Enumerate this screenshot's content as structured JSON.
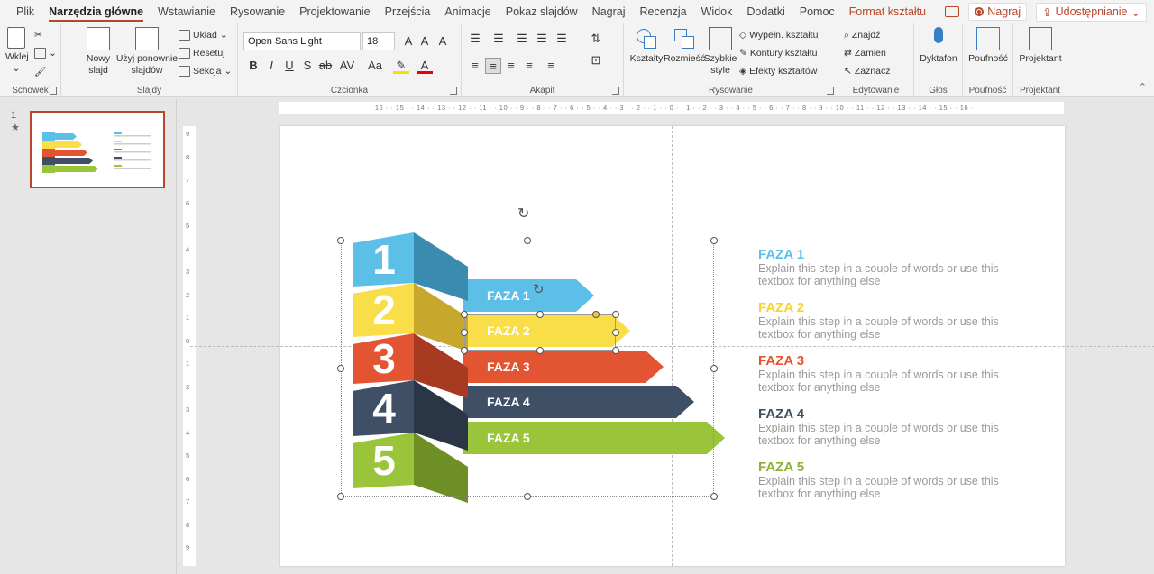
{
  "menu": {
    "tabs": [
      "Plik",
      "Narzędzia główne",
      "Wstawianie",
      "Rysowanie",
      "Projektowanie",
      "Przejścia",
      "Animacje",
      "Pokaz slajdów",
      "Nagraj",
      "Recenzja",
      "Widok",
      "Dodatki",
      "Pomoc",
      "Format kształtu"
    ],
    "record": "Nagraj",
    "share": "Udostępnianie"
  },
  "ribbon": {
    "clipboard": {
      "paste": "Wklej",
      "label": "Schowek"
    },
    "slides": {
      "new_slide": "Nowy slajd",
      "reuse": "Użyj ponownie slajdów",
      "layout": "Układ",
      "reset": "Resetuj",
      "section": "Sekcja",
      "label": "Slajdy"
    },
    "font": {
      "name": "Open Sans Light",
      "size": "18",
      "label": "Czcionka"
    },
    "paragraph": {
      "label": "Akapit"
    },
    "drawing": {
      "shapes": "Kształty",
      "arrange": "Rozmieść",
      "quick_styles": "Szybkie style",
      "fill": "Wypełn. kształtu",
      "outline": "Kontury kształtu",
      "effects": "Efekty kształtów",
      "label": "Rysowanie"
    },
    "editing": {
      "find": "Znajdź",
      "replace": "Zamień",
      "select": "Zaznacz",
      "label": "Edytowanie"
    },
    "voice": {
      "dictate": "Dyktafon",
      "label": "Głos"
    },
    "sensitivity": {
      "btn": "Poufność",
      "label": "Poufność"
    },
    "designer": {
      "btn": "Projektant",
      "label": "Projektant"
    }
  },
  "ruler": {
    "h": "· 16 · · 15 · · 14 · · 13 · · 12 · · 11 · · 10 · · 9 · · 8 · · 7 · · 6 · · 5 · · 4 · · 3 · · 2 · · 1 · · 0 · · 1 · · 2 · · 3 · · 4 · · 5 · · 6 · · 7 · · 8 · · 9 · · 10 · · 11 · · 12 · · 13 · · 14 · · 15 · · 16 ·",
    "v": [
      "9",
      "8",
      "7",
      "6",
      "5",
      "4",
      "3",
      "2",
      "1",
      "0",
      "1",
      "2",
      "3",
      "4",
      "5",
      "6",
      "7",
      "8",
      "9"
    ]
  },
  "thumbs": {
    "num": "1",
    "star": "★"
  },
  "slide": {
    "steps": [
      {
        "num": "1",
        "label": "FAZA 1",
        "color": "#5bbfe8",
        "side": "#3a8bb0"
      },
      {
        "num": "2",
        "label": "FAZA 2",
        "color": "#f9de4a",
        "side": "#c8a82c"
      },
      {
        "num": "3",
        "label": "FAZA 3",
        "color": "#e35532",
        "side": "#a93a22"
      },
      {
        "num": "4",
        "label": "FAZA 4",
        "color": "#3f4f66",
        "side": "#2a3546"
      },
      {
        "num": "5",
        "label": "FAZA 5",
        "color": "#9ac43a",
        "side": "#6d8f25"
      }
    ],
    "texts": [
      {
        "title": "FAZA 1",
        "desc": "Explain this step in a couple of words or use this textbox for anything else",
        "color": "#5bbfe8"
      },
      {
        "title": "FAZA 2",
        "desc": "Explain this step in a couple of words or use this textbox for anything else",
        "color": "#f5d42c"
      },
      {
        "title": "FAZA 3",
        "desc": "Explain this step in a couple of words or use this textbox for anything else",
        "color": "#e35532"
      },
      {
        "title": "FAZA 4",
        "desc": "Explain this step in a couple of words or use this textbox for anything else",
        "color": "#3f4f66"
      },
      {
        "title": "FAZA 5",
        "desc": "Explain this step in a couple of words or use this textbox for anything else",
        "color": "#8bb32f"
      }
    ]
  }
}
